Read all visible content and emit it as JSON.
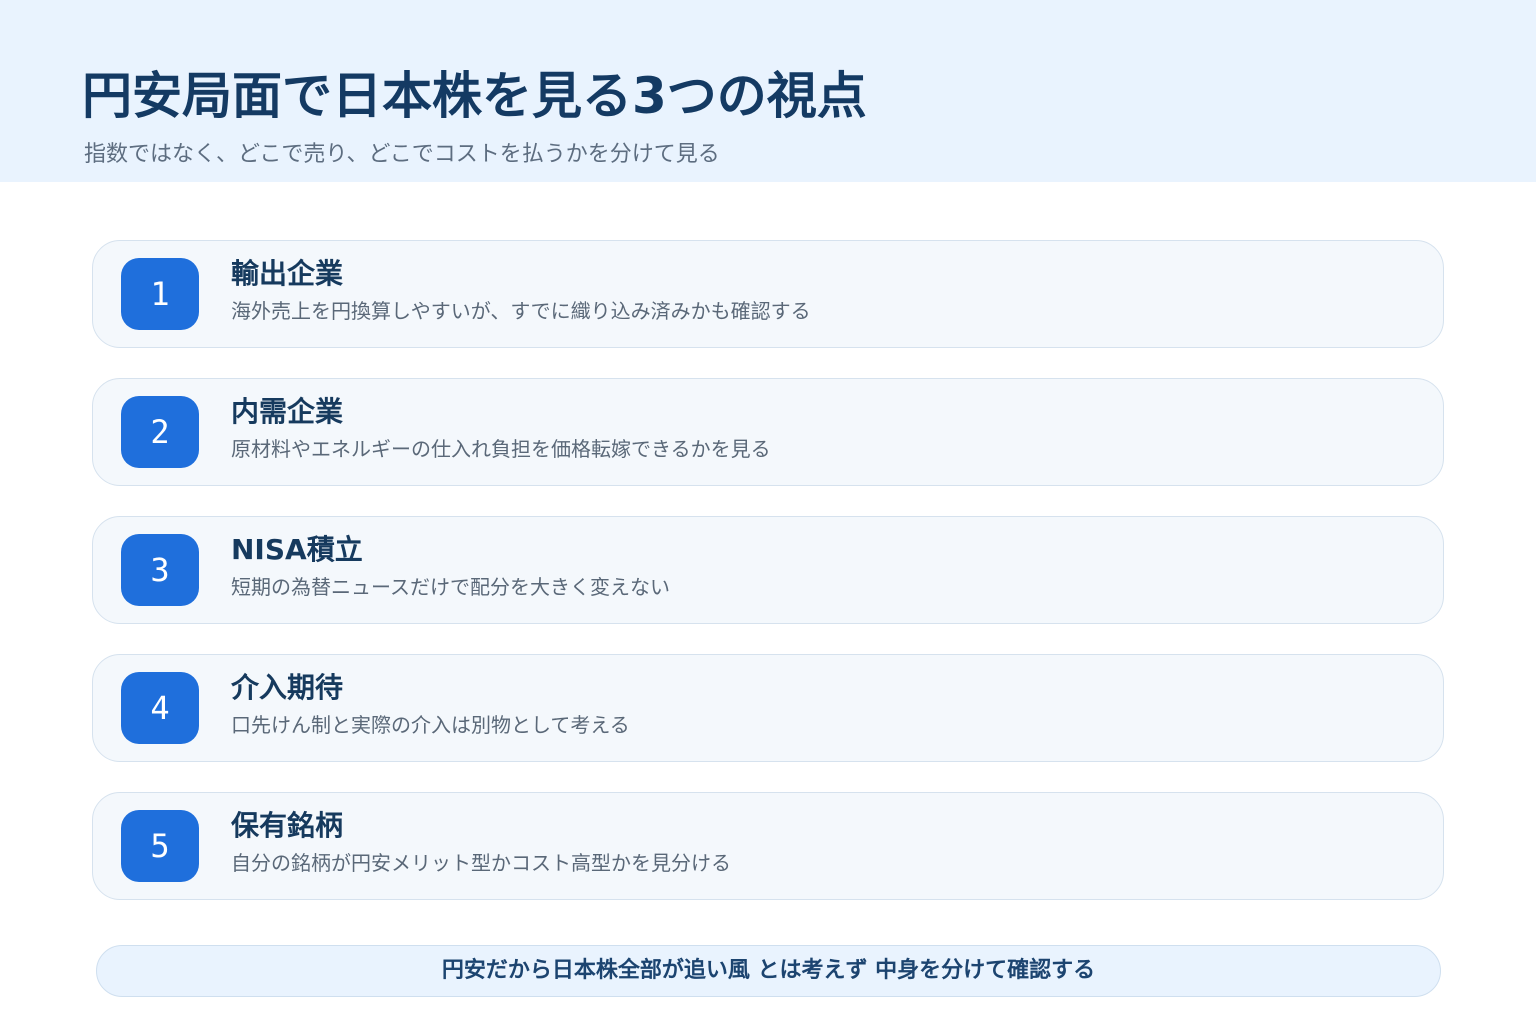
{
  "header": {
    "title": "円安局面で日本株を見る3つの視点",
    "subtitle": "指数ではなく、どこで売り、どこでコストを払うかを分けて見る"
  },
  "items": [
    {
      "number": "1",
      "title": "輸出企業",
      "description": "海外売上を円換算しやすいが、すでに織り込み済みかも確認する"
    },
    {
      "number": "2",
      "title": "内需企業",
      "description": "原材料やエネルギーの仕入れ負担を価格転嫁できるかを見る"
    },
    {
      "number": "3",
      "title": "NISA積立",
      "description": "短期の為替ニュースだけで配分を大きく変えない"
    },
    {
      "number": "4",
      "title": "介入期待",
      "description": "口先けん制と実際の介入は別物として考える"
    },
    {
      "number": "5",
      "title": "保有銘柄",
      "description": "自分の銘柄が円安メリット型かコスト高型かを見分ける"
    }
  ],
  "footer": {
    "note": "円安だから日本株全部が追い風 とは考えず 中身を分けて確認する"
  },
  "colors": {
    "header_bg": "#e9f3fe",
    "title": "#143a63",
    "badge": "#1f6fdc",
    "card_bg": "#f4f8fc",
    "card_border": "#d6e2ee"
  }
}
